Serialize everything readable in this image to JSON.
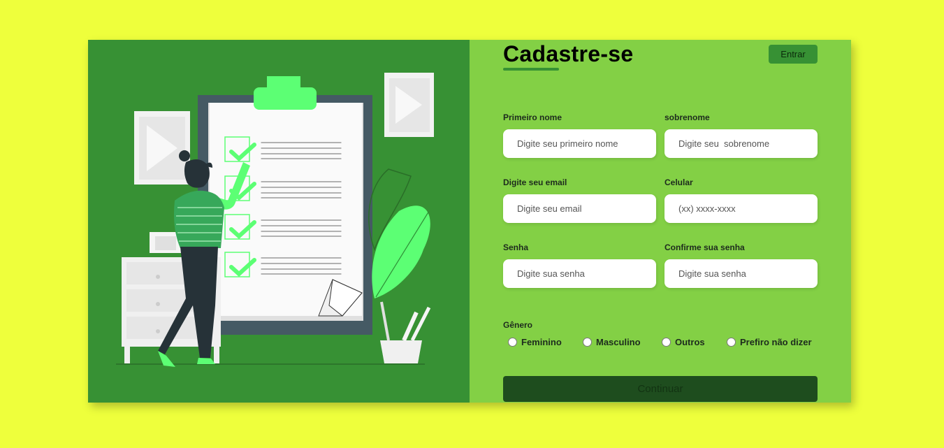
{
  "form": {
    "title": "Cadastre-se",
    "login_button": "Entrar",
    "fields": {
      "first_name": {
        "label": "Primeiro nome",
        "placeholder": "Digite seu primeiro nome"
      },
      "last_name": {
        "label": "sobrenome",
        "placeholder": "Digite seu  sobrenome"
      },
      "email": {
        "label": "Digite seu email",
        "placeholder": "Digite seu email"
      },
      "phone": {
        "label": "Celular",
        "placeholder": "(xx) xxxx-xxxx"
      },
      "password": {
        "label": "Senha",
        "placeholder": "Digite sua senha"
      },
      "confirm_password": {
        "label": "Confirme sua senha",
        "placeholder": "Digite sua senha"
      }
    },
    "gender": {
      "label": "Gênero",
      "options": [
        "Feminino",
        "Masculino",
        "Outros",
        "Prefiro não dizer"
      ]
    },
    "continue_button": "Continuar"
  },
  "colors": {
    "page_background": "#eeff3c",
    "left_panel": "#379134",
    "right_panel": "#83d045",
    "accent_green": "#5cff74",
    "continue_button": "#1e4d1e"
  },
  "illustration": {
    "subject": "checklist-illustration"
  }
}
